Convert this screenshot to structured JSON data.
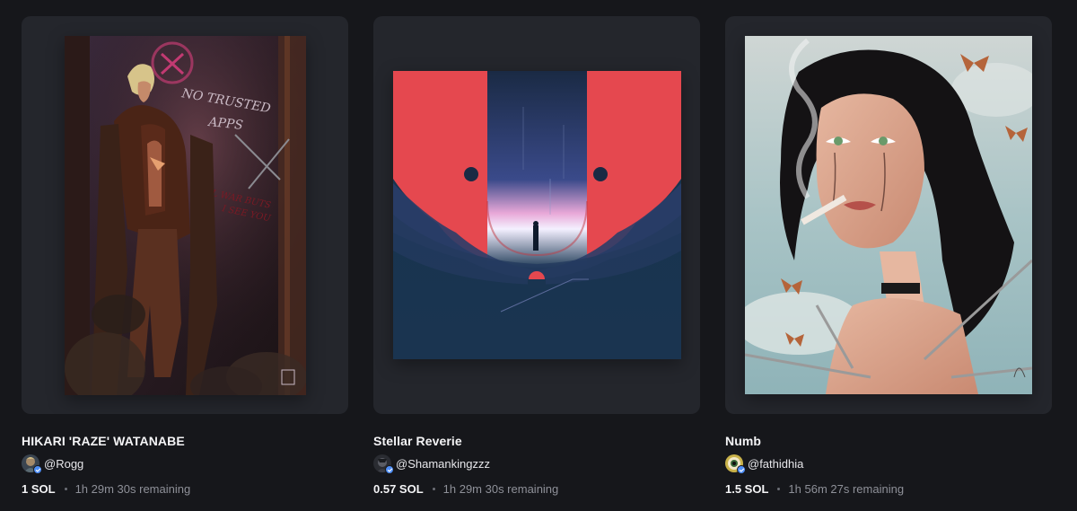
{
  "cards": [
    {
      "title": "HIKARI 'RAZE' WATANABE",
      "creator": "@Rogg",
      "price": "1 SOL",
      "time_remaining": "1h 29m 30s remaining",
      "art_icon": "character-portrait-artwork",
      "art_text": [
        "NO TRUSTED",
        "APPS",
        "ALL WAR BUTS",
        "I SEE YOU"
      ]
    },
    {
      "title": "Stellar Reverie",
      "creator": "@Shamankingzzz",
      "price": "0.57 SOL",
      "time_remaining": "1h 29m 30s remaining",
      "art_icon": "surreal-portal-artwork"
    },
    {
      "title": "Numb",
      "creator": "@fathidhia",
      "price": "1.5 SOL",
      "time_remaining": "1h 56m 27s remaining",
      "art_icon": "woman-butterflies-artwork"
    }
  ],
  "colors": {
    "background": "#16171b",
    "card": "#24262c",
    "verified": "#4f8ff7",
    "muted_text": "#8e9098"
  }
}
